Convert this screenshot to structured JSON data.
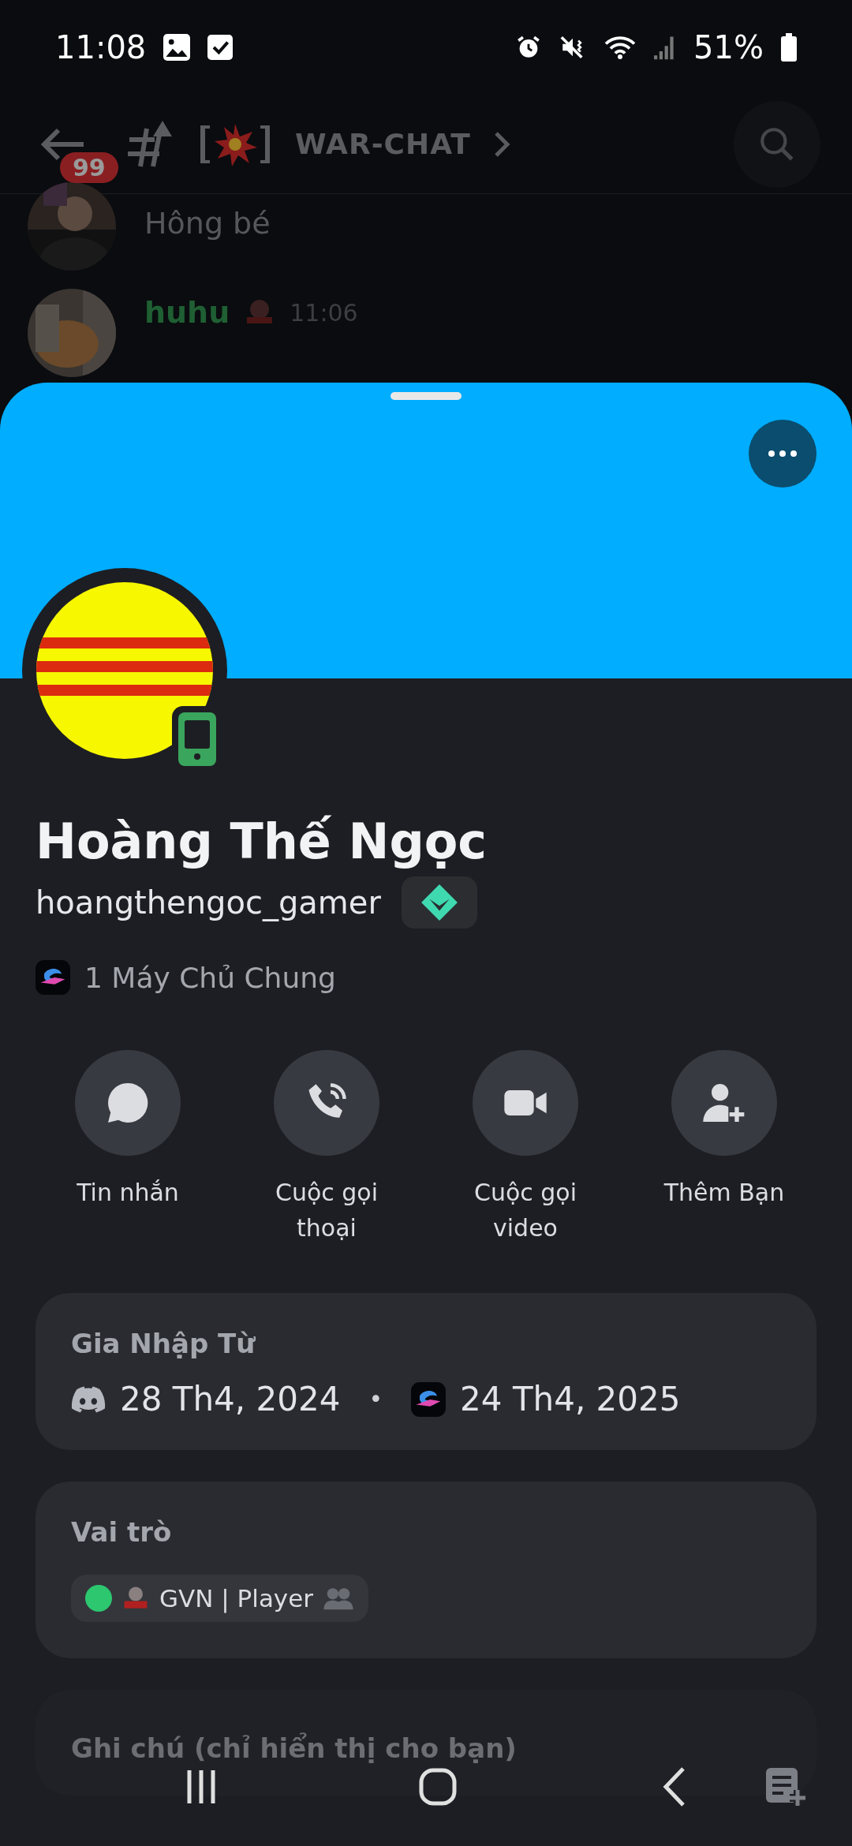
{
  "status_bar": {
    "time": "11:08",
    "battery": "51%"
  },
  "header": {
    "unread_badge": "99",
    "channel_name": "WAR-CHAT"
  },
  "messages": [
    {
      "text": "Hông bé"
    },
    {
      "author": "huhu",
      "time": "11:06"
    }
  ],
  "profile": {
    "display_name": "Hoàng Thế Ngọc",
    "username": "hoangthengoc_gamer",
    "mutual_servers": "1 Máy Chủ Chung"
  },
  "actions": [
    {
      "label": "Tin nhắn",
      "kind": "message"
    },
    {
      "label": "Cuộc gọi thoại",
      "kind": "call"
    },
    {
      "label": "Cuộc gọi video",
      "kind": "video"
    },
    {
      "label": "Thêm Bạn",
      "kind": "add-friend"
    }
  ],
  "member_since": {
    "title": "Gia Nhập Từ",
    "discord_date": "28 Th4, 2024",
    "separator": "•",
    "server_date": "24 Th4, 2025"
  },
  "roles": {
    "title": "Vai trò",
    "items": [
      {
        "name": "GVN | Player",
        "color": "#2dc770"
      }
    ]
  },
  "note": {
    "title": "Ghi chú (chỉ hiển thị cho bạn)"
  }
}
